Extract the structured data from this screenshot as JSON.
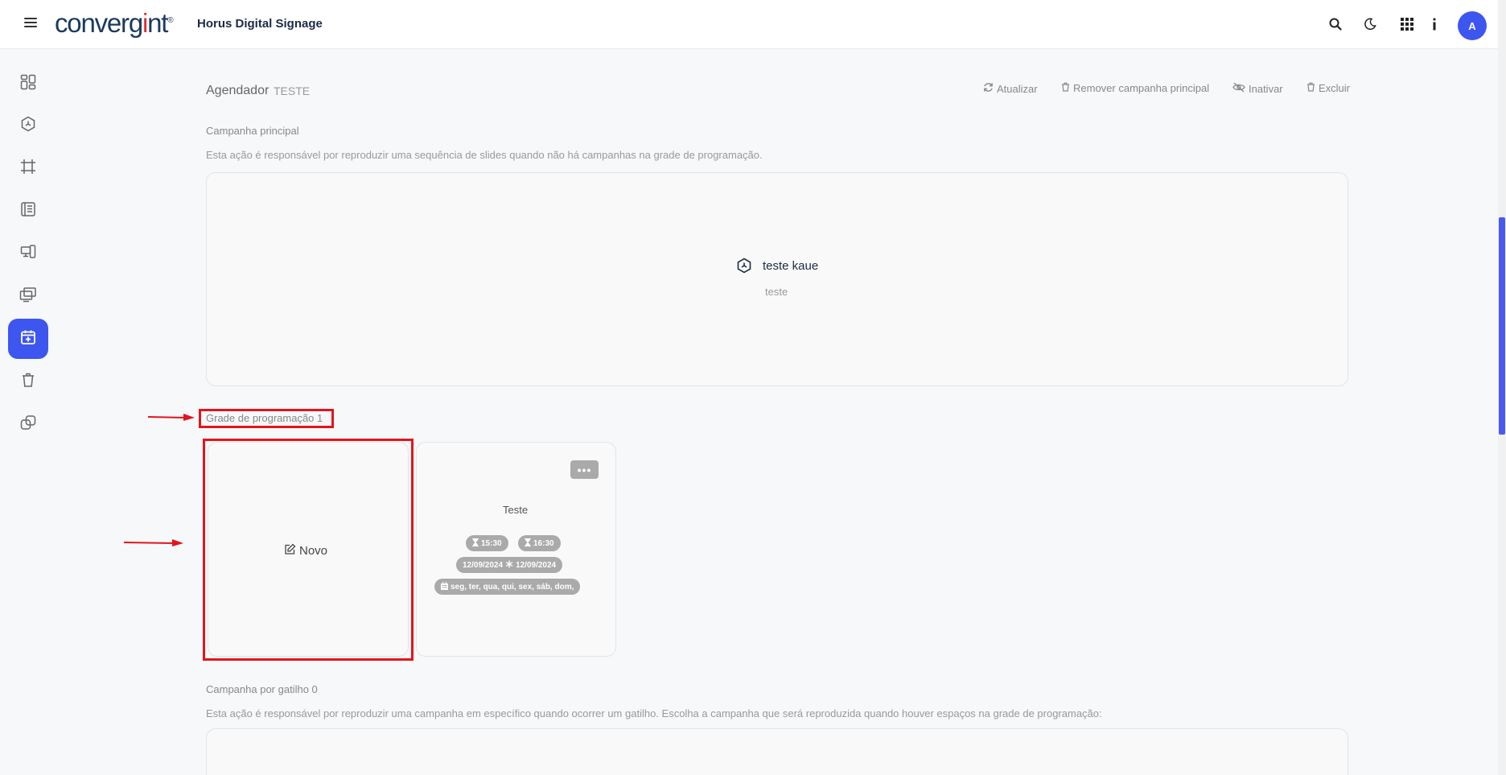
{
  "header": {
    "logo": {
      "pre": "converg",
      "accent": "i",
      "post": "nt",
      "mark": "®"
    },
    "app_title": "Horus Digital Signage",
    "avatar_initial": "A",
    "icons": [
      "search-icon",
      "moon-icon",
      "grid-apps-icon",
      "info-icon"
    ]
  },
  "sidebar": {
    "items": [
      {
        "icon": "dashboard-icon"
      },
      {
        "icon": "campaign-hexagon-icon"
      },
      {
        "icon": "crop-frame-icon"
      },
      {
        "icon": "book-icon"
      },
      {
        "icon": "devices-icon"
      },
      {
        "icon": "screens-icon"
      },
      {
        "icon": "calendar-add-icon",
        "active": true
      },
      {
        "icon": "trash-icon"
      },
      {
        "icon": "integrations-icon"
      }
    ]
  },
  "page": {
    "title": "Agendador",
    "subtitle": "TESTE",
    "actions": {
      "refresh": "Atualizar",
      "remove_main": "Remover campanha principal",
      "deactivate": "Inativar",
      "delete": "Excluir"
    }
  },
  "main_campaign": {
    "label": "Campanha principal",
    "description": "Esta ação é responsável por reproduzir uma sequência de slides quando não há campanhas na grade de programação.",
    "name": "teste kaue",
    "sub": "teste"
  },
  "schedule_grid": {
    "label": "Grade de programação 1",
    "new_label": "Novo",
    "menu_label": "•••",
    "card": {
      "title": "Teste",
      "start_time": "15:30",
      "end_time": "16:30",
      "start_date": "12/09/2024",
      "end_date": "12/09/2024",
      "days": "seg, ter, qua, qui, sex, sáb, dom,"
    }
  },
  "trigger_campaign": {
    "label": "Campanha por gatilho 0",
    "description": "Esta ação é responsável por reproduzir uma campanha em específico quando ocorrer um gatilho. Escolha a campanha que será reproduzida quando houver espaços na grade de programação:"
  },
  "colors": {
    "accent": "#3d56f0",
    "annotation_red": "#e4141c",
    "pill_gray": "#aaaaaa"
  }
}
